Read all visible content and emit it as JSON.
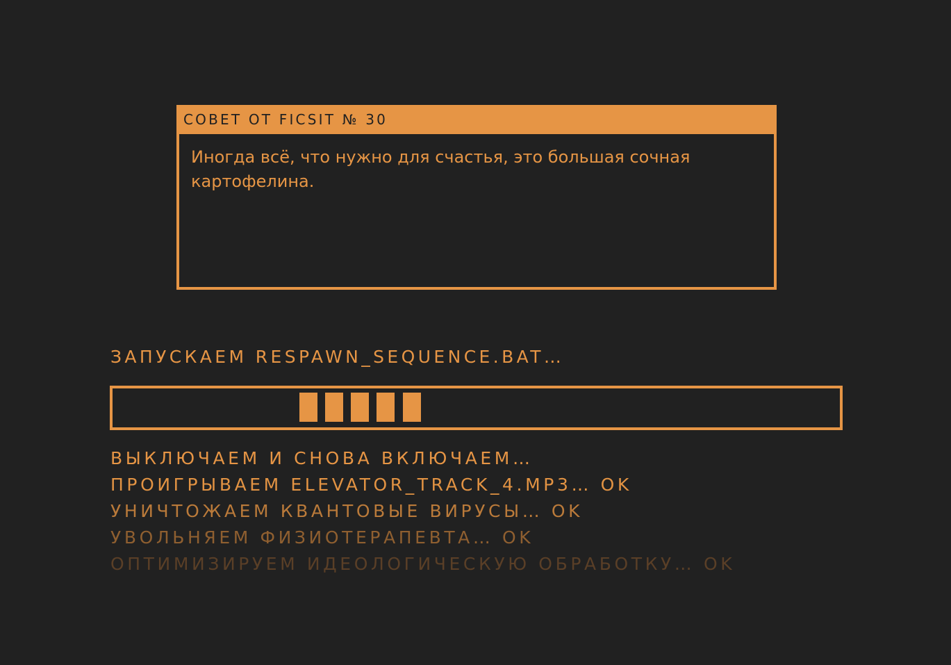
{
  "tip": {
    "header": "СОВЕТ ОТ FICSIT № 30",
    "body": "Иногда всё, что нужно для счастья, это большая сочная картофелина."
  },
  "status": {
    "heading": "ЗАПУСКАЕМ RESPAWN_SEQUENCE.BAT…"
  },
  "progress": {
    "segment_count": 5,
    "state": "indeterminate"
  },
  "log": [
    {
      "text": "ВЫКЛЮЧАЕМ И СНОВА ВКЛЮЧАЕМ…",
      "color": "#e69545"
    },
    {
      "text": "ПРОИГРЫВАЕМ ELEVATOR_TRACK_4.MP3… OK",
      "color": "#e29343"
    },
    {
      "text": "УНИЧТОЖАЕМ КВАНТОВЫЕ ВИРУСЫ… OK",
      "color": "#ba7a3a"
    },
    {
      "text": "УВОЛЬНЯЕМ ФИЗИОТЕРАПЕВТА… OK",
      "color": "#8f5f30"
    },
    {
      "text": "ОПТИМИЗИРУЕМ ИДЕОЛОГИЧЕСКУЮ ОБРАБОТКУ… OK",
      "color": "#5a3f27"
    }
  ],
  "colors": {
    "background": "#212121",
    "accent": "#e69545"
  }
}
